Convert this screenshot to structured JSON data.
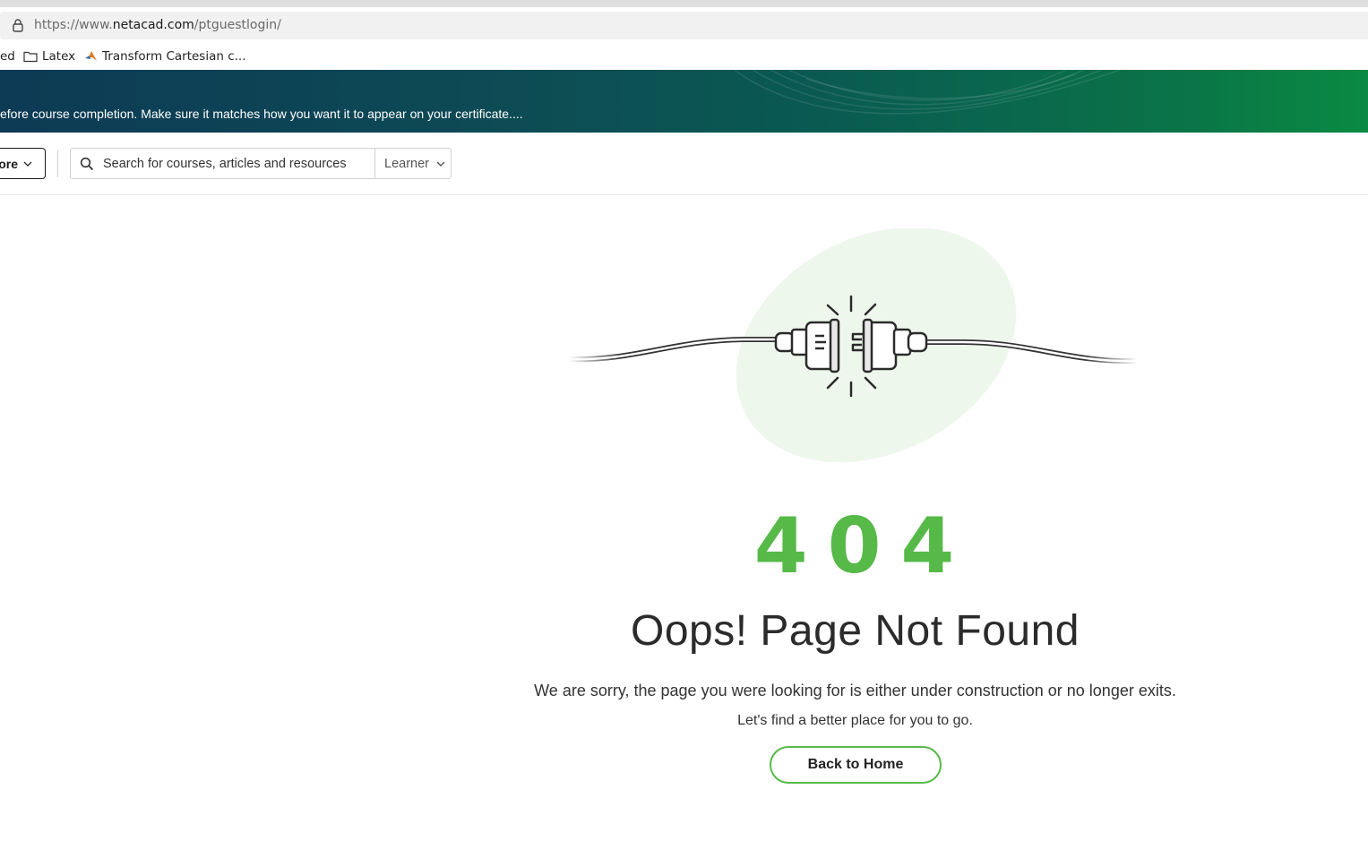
{
  "browser": {
    "url_prefix": "https://www.",
    "url_host": "netacad.com",
    "url_path": "/ptguestlogin/",
    "bookmarks": [
      {
        "label": "ed",
        "icon": "none"
      },
      {
        "label": "Latex",
        "icon": "folder-icon"
      },
      {
        "label": "Transform Cartesian c...",
        "icon": "matlab-icon"
      }
    ]
  },
  "banner": {
    "text": "efore course completion. Make sure it matches how you want it to appear on your certificate...."
  },
  "nav": {
    "explore_label": "ore",
    "search_placeholder": "Search for courses, articles and resources",
    "role_label": "Learner"
  },
  "error": {
    "code_digits": [
      "4",
      "0",
      "4"
    ],
    "title": "Oops! Page Not Found",
    "message": "We are sorry, the page you were looking for is either under construction or no longer exits.",
    "submessage": "Let's find a better place for you to go.",
    "button_label": "Back to Home"
  },
  "colors": {
    "accent_green": "#56b948",
    "blob_green": "#eef7ec",
    "banner_start": "#0d3a55",
    "banner_end": "#0a8a42"
  }
}
